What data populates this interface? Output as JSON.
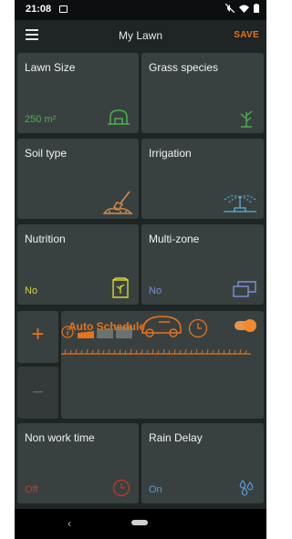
{
  "status_bar": {
    "time": "21:08"
  },
  "app_bar": {
    "title": "My Lawn",
    "save_label": "SAVE"
  },
  "tiles": {
    "lawn_size": {
      "label": "Lawn Size",
      "value": "250 m²"
    },
    "grass_species": {
      "label": "Grass species"
    },
    "soil_type": {
      "label": "Soil type"
    },
    "irrigation": {
      "label": "Irrigation"
    },
    "nutrition": {
      "label": "Nutrition",
      "value": "No"
    },
    "multi_zone": {
      "label": "Multi-zone",
      "value": "No"
    },
    "non_work_time": {
      "label": "Non work time",
      "value": "Off"
    },
    "rain_delay": {
      "label": "Rain Delay",
      "value": "On"
    }
  },
  "auto_schedule": {
    "label": "Auto Schedule",
    "enabled": true
  },
  "stepper": {
    "plus": "+",
    "minus": "−"
  },
  "colors": {
    "accent": "#e8731c",
    "green": "#4caf50",
    "yellow": "#d4d435",
    "blue": "#5b9bd5",
    "red": "#c0392b",
    "tile_bg": "#394140"
  }
}
